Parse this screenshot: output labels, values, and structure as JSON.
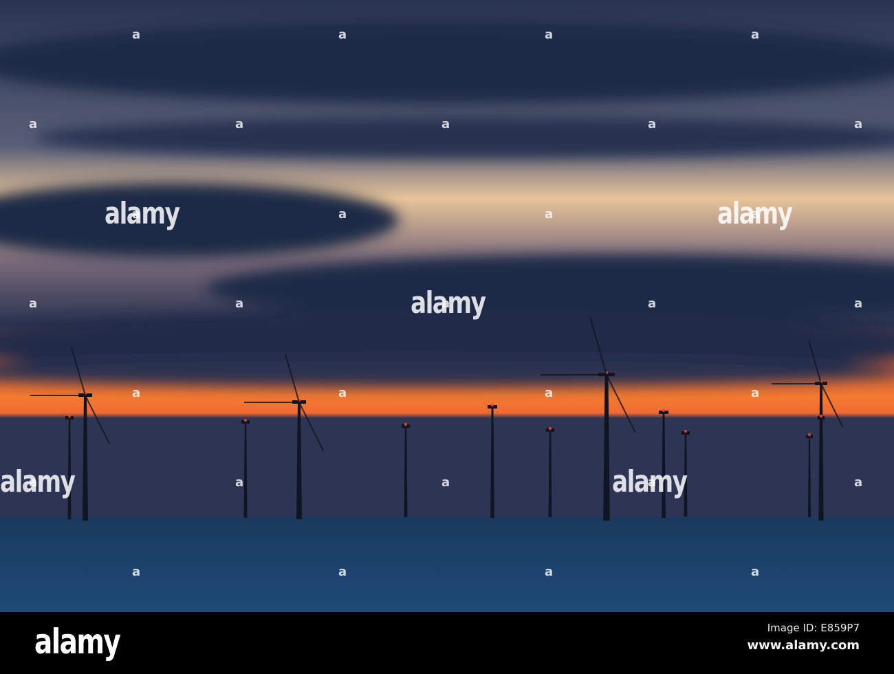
{
  "photo": {
    "subject": "offshore-wind-farm-at-sunset",
    "colors": {
      "sky_top": "#2a3550",
      "cloud": "#1f2a45",
      "glow": "#f0a060",
      "horizon": "#f06a30",
      "sea": "#1c3f66",
      "turbine": "#0f1522",
      "light": "#ff4020"
    }
  },
  "watermark": {
    "text": "alamy",
    "mark": "a"
  },
  "footer": {
    "logo": "alamy",
    "image_id": "Image ID: E859P7",
    "url": "www.alamy.com"
  }
}
